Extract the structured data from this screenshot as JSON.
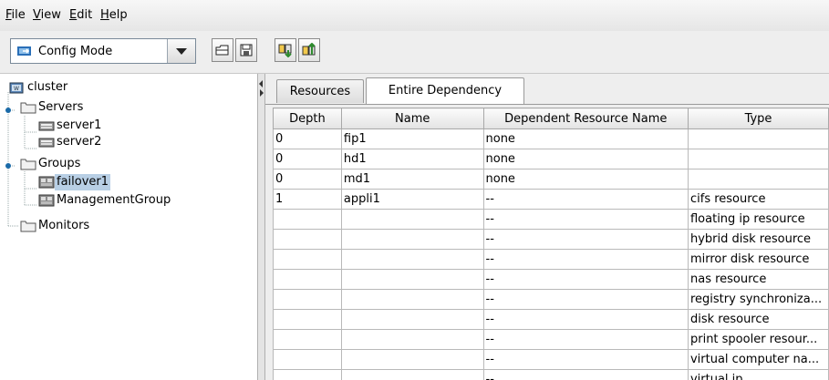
{
  "menu": [
    "File",
    "View",
    "Edit",
    "Help"
  ],
  "toolbar": {
    "mode_label": "Config Mode"
  },
  "tree": {
    "root": "cluster",
    "servers_label": "Servers",
    "servers": [
      "server1",
      "server2"
    ],
    "groups_label": "Groups",
    "groups": [
      "failover1",
      "ManagementGroup"
    ],
    "monitors_label": "Monitors"
  },
  "tabs": [
    "Resources",
    "Entire Dependency"
  ],
  "table": {
    "headers": [
      "Depth",
      "Name",
      "Dependent Resource Name",
      "Type"
    ],
    "rows": [
      [
        "0",
        "fip1",
        "none",
        ""
      ],
      [
        "0",
        "hd1",
        "none",
        ""
      ],
      [
        "0",
        "md1",
        "none",
        ""
      ],
      [
        "1",
        "appli1",
        "--",
        "cifs resource"
      ],
      [
        "",
        "",
        "--",
        "floating ip resource"
      ],
      [
        "",
        "",
        "--",
        "hybrid disk resource"
      ],
      [
        "",
        "",
        "--",
        "mirror disk resource"
      ],
      [
        "",
        "",
        "--",
        "nas resource"
      ],
      [
        "",
        "",
        "--",
        "registry synchroniza..."
      ],
      [
        "",
        "",
        "--",
        "disk resource"
      ],
      [
        "",
        "",
        "--",
        "print spooler resour..."
      ],
      [
        "",
        "",
        "--",
        "virtual computer na..."
      ],
      [
        "",
        "",
        "--",
        "virtual ip"
      ]
    ]
  }
}
